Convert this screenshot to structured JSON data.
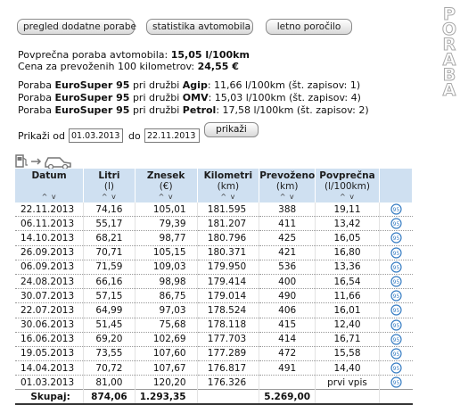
{
  "nav": {
    "btn1": "pregled dodatne porabe",
    "btn2": "statistika avtomobila",
    "btn3": "letno poročilo"
  },
  "brand": {
    "vertical_label": "PORABA"
  },
  "summary": {
    "avg_label": "Povprečna poraba avtomobila: ",
    "avg_value": "15,05 l/100km",
    "cost_label": "Cena za prevoženih 100 kilometrov: ",
    "cost_value": "24,55 €"
  },
  "stations": [
    {
      "p1": "Poraba ",
      "fuel": "EuroSuper 95",
      "p2": " pri družbi ",
      "company": "Agip",
      "p3": ": 11,66 l/100km (št. zapisov: 1)"
    },
    {
      "p1": "Poraba ",
      "fuel": "EuroSuper 95",
      "p2": " pri družbi ",
      "company": "OMV",
      "p3": ": 15,03 l/100km (št. zapisov: 4)"
    },
    {
      "p1": "Poraba ",
      "fuel": "EuroSuper 95",
      "p2": " pri družbi ",
      "company": "Petrol",
      "p3": ": 17,58 l/100km (št. zapisov: 2)"
    }
  ],
  "filter": {
    "from_label": "Prikaži od",
    "from_value": "01.03.2013",
    "to_label": "do",
    "to_value": "22.11.2013",
    "submit": "prikaži"
  },
  "table": {
    "headers": [
      {
        "title": "Datum",
        "unit": "",
        "sort": "^ v"
      },
      {
        "title": "Litri",
        "unit": "(l)",
        "sort": "^ v"
      },
      {
        "title": "Znesek",
        "unit": "(€)",
        "sort": "^ v"
      },
      {
        "title": "Kilometri",
        "unit": "(km)",
        "sort": "^ v"
      },
      {
        "title": "Prevoženo",
        "unit": "(km)",
        "sort": "^ v"
      },
      {
        "title": "Povprečna",
        "unit": "(l/100km)",
        "sort": "^ v"
      }
    ],
    "row_icon": "fuel-95-icon",
    "rows": [
      [
        "22.11.2013",
        "74,16",
        "105,01",
        "181.595",
        "388",
        "19,11"
      ],
      [
        "06.11.2013",
        "55,17",
        "79,39",
        "181.207",
        "411",
        "13,42"
      ],
      [
        "14.10.2013",
        "68,21",
        "98,77",
        "180.796",
        "425",
        "16,05"
      ],
      [
        "26.09.2013",
        "70,71",
        "105,15",
        "180.371",
        "421",
        "16,80"
      ],
      [
        "06.09.2013",
        "71,59",
        "109,03",
        "179.950",
        "536",
        "13,36"
      ],
      [
        "24.08.2013",
        "66,16",
        "98,98",
        "179.414",
        "400",
        "16,54"
      ],
      [
        "30.07.2013",
        "57,15",
        "86,75",
        "179.014",
        "490",
        "11,66"
      ],
      [
        "22.07.2013",
        "64,99",
        "97,03",
        "178.524",
        "406",
        "16,01"
      ],
      [
        "30.06.2013",
        "51,45",
        "75,68",
        "178.118",
        "415",
        "12,40"
      ],
      [
        "16.06.2013",
        "69,20",
        "102,69",
        "177.703",
        "414",
        "16,71"
      ],
      [
        "19.05.2013",
        "73,55",
        "107,60",
        "177.289",
        "472",
        "15,58"
      ],
      [
        "14.04.2013",
        "70,72",
        "107,67",
        "176.817",
        "491",
        "14,40"
      ],
      [
        "01.03.2013",
        "81,00",
        "120,20",
        "176.326",
        "",
        "prvi vpis"
      ]
    ],
    "totals": [
      "Skupaj:",
      "874,06",
      "1.293,35",
      "",
      "5.269,00",
      ""
    ]
  }
}
